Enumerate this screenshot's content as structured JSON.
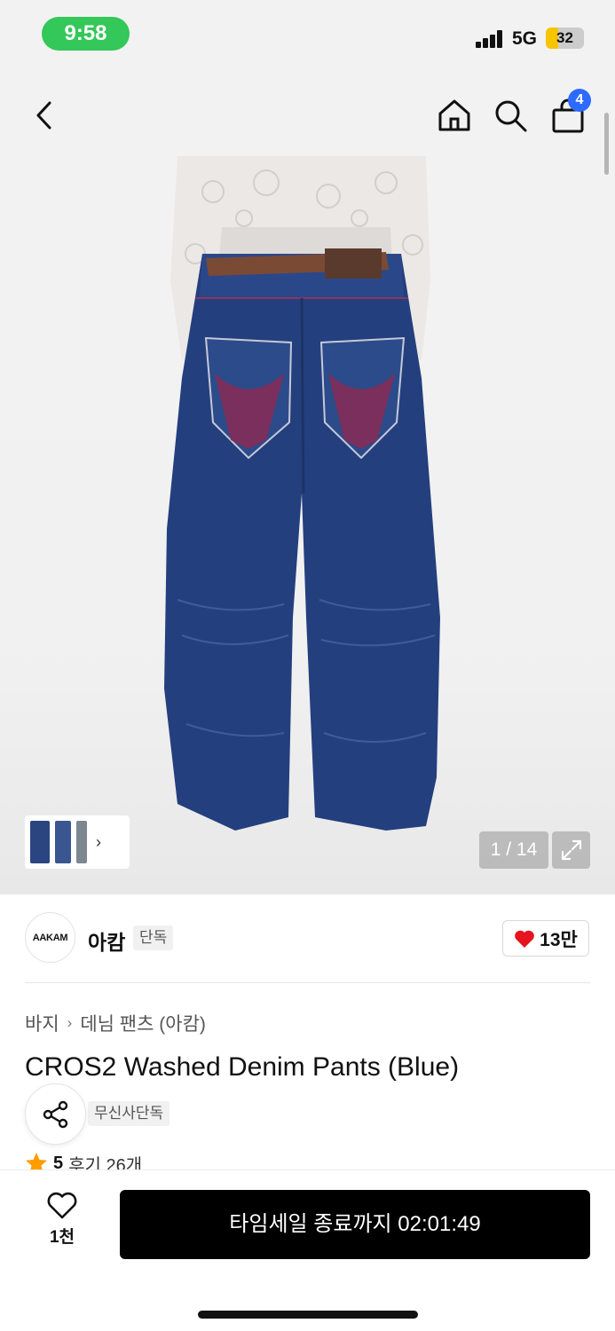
{
  "status_bar": {
    "time": "9:58",
    "network": "5G",
    "battery_text": "32",
    "battery_level": 0.32
  },
  "top_nav": {
    "icons": [
      "chevron-left-icon",
      "home-icon",
      "search-icon",
      "shopping-bag-icon"
    ],
    "cart_badge": "4"
  },
  "gallery": {
    "counter": "1 / 14",
    "image_description_icon": "product-photo"
  },
  "brand": {
    "logo_text": "AAKAM",
    "name": "아캄",
    "tag": "단독",
    "like_count": "13만"
  },
  "breadcrumb": {
    "category": "바지",
    "subcategory": "데님 팬츠 (아캄)"
  },
  "product": {
    "title": "CROS2 Washed Denim Pants (Blue)",
    "tag": "무신사단독",
    "rating": "5",
    "reviews": "후기 26개"
  },
  "bottom_bar": {
    "wish_count": "1천",
    "cta_label": "타임세일 종료까지 02:01:49"
  },
  "colors": {
    "time_pill": "#34c759",
    "cart_badge": "#2d6bff",
    "heart": "#e5141e",
    "star": "#ff9c00",
    "cta_bg": "#000000"
  }
}
